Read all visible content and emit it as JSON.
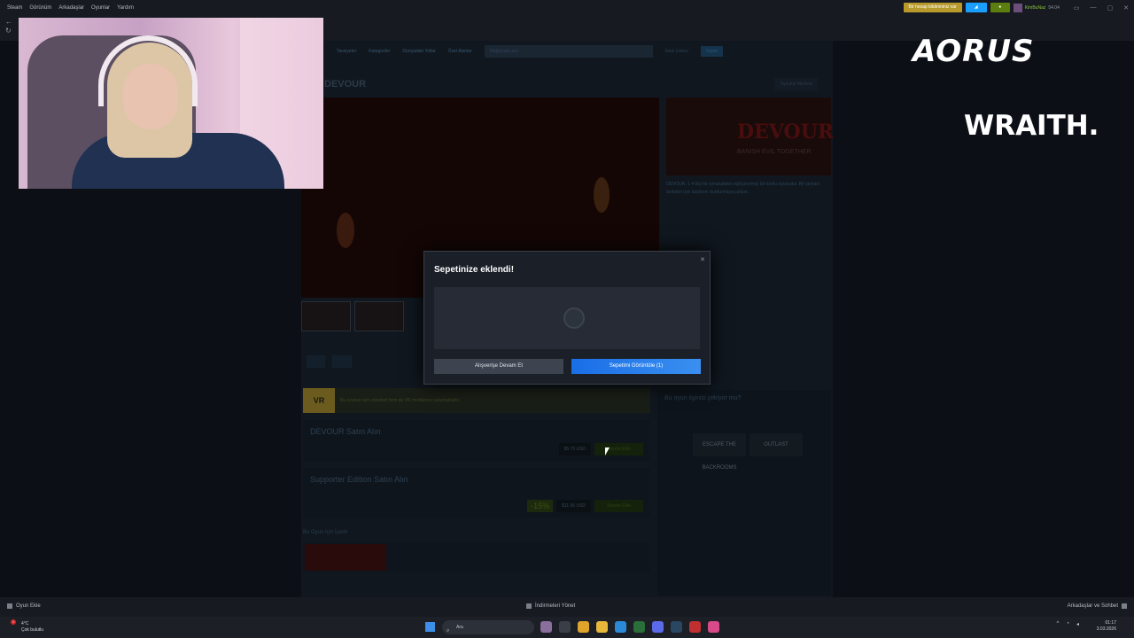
{
  "topbar": {
    "menu": [
      "Steam",
      "Görünüm",
      "Arkadaşlar",
      "Oyunlar",
      "Yardım"
    ],
    "notice": "Bir hesap bildiriminiz var",
    "username": "KimBuNaz",
    "balance": "54.04"
  },
  "store": {
    "nav": [
      "Tavsiyeler",
      "Kategoriler",
      "Dünyadaki Yollar",
      "Özel Alanlar"
    ],
    "search_placeholder": "Mağazada ara",
    "wishlist": "İstek Listesi",
    "cart": "Sepet",
    "game_title": "DEVOUR",
    "community_hub": "Topluluk Merkezi",
    "capsule_logo": "DEVOUR",
    "capsule_tagline": "BANISH EVIL TOGETHER",
    "description": "DEVOUR, 1-4 kişi ile oynanabilen eşli/çevrimiçi bir korku oyunudur. Bir şeytani tarikatın üye başlarını durdurmaya çalışın.",
    "vr_badge": "VR",
    "vr_note": "Bu oyunun tam standart hem de VR modlarına çalışmaktadır.",
    "buy_title": "DEVOUR Satın Alın",
    "buy_price": "$5.79 USD",
    "add_to_cart": "Sepete Ekle",
    "supporter_title": "Supporter Edition Satın Alın",
    "supporter_discount": "-15%",
    "supporter_price": "$11.96 USD",
    "content_head": "Bu Oyun İçin İçerik",
    "sidebar_heading": "Bu oyun ilginizi çekiyor mu?",
    "related_games": [
      "ESCAPE THE BACKROOMS",
      "OUTLAST"
    ]
  },
  "overlay": {
    "brand1": "AORUS",
    "brand2": "WRAITH."
  },
  "modal": {
    "title": "Sepetinize eklendi!",
    "continue_label": "Alışverişe Devam Et",
    "view_cart_label": "Sepetimi Görüntüle (1)"
  },
  "bottombar": {
    "add_game": "Oyun Ekle",
    "downloads": "İndirmeleri Yönet",
    "friends": "Arkadaşlar ve Sohbet"
  },
  "taskbar": {
    "weather_temp": "4°C",
    "weather_desc": "Çok bulutlu",
    "weather_badge": "4",
    "search_label": "Ara",
    "time": "01:17",
    "date": "3.03.2026"
  },
  "colors": {
    "steam_blue": "#1a9fff",
    "cart_green": "#5c7e10",
    "notice_gold": "#b89a2c"
  }
}
